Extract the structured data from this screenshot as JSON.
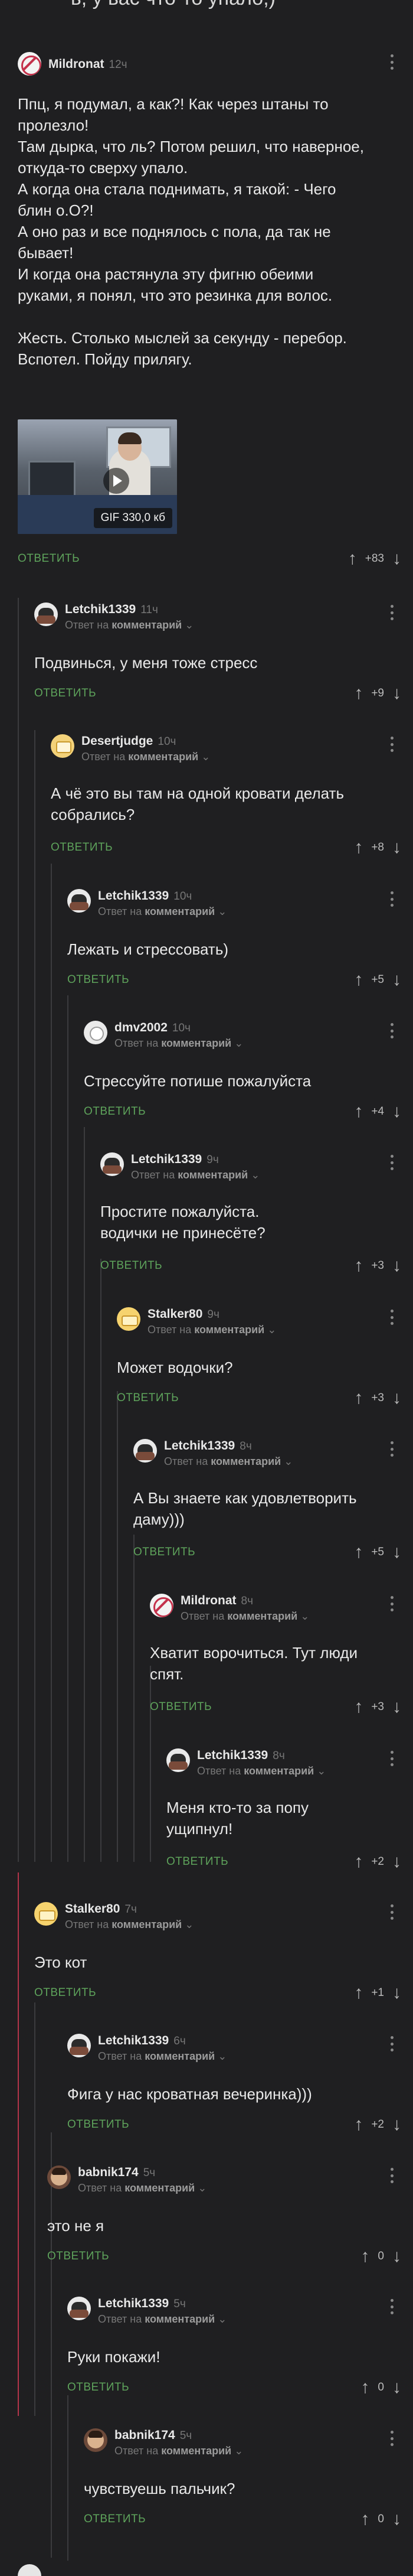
{
  "top_text": "ь, у вас что-то упало,)",
  "comments": [
    {
      "author": "Mildronat",
      "time": "12ч",
      "text": "Ппц, я подумал, а как?! Как через штаны то\nпролезло!\nТам дырка, что ль? Потом решил, что наверное,\nоткуда-то сверху упало.\nА когда она стала поднимать, я такой: - Чего\nблин о.О?!\nА оно раз и все поднялось с пола, да так не\nбывает!\nИ когда она растянула эту фигню обеими\nруками, я понял, что это резинка для волос.\n\nЖесть. Столько мыслей за секунду - перебор.\nВспотел. Пойду прилягу.",
      "gif_label": "GIF 330,0 кб",
      "reply": "ОТВЕТИТЬ",
      "score": "+83"
    },
    {
      "author": "Letchik1339",
      "time": "11ч",
      "reply_prefix": "Ответ на",
      "reply_target": "комментарий",
      "text": "Подвинься, у меня тоже стресс",
      "reply": "ОТВЕТИТЬ",
      "score": "+9"
    },
    {
      "author": "Desertjudge",
      "time": "10ч",
      "reply_prefix": "Ответ на",
      "reply_target": "комментарий",
      "text": "А чё это вы там на одной кровати делать\nсобрались?",
      "reply": "ОТВЕТИТЬ",
      "score": "+8"
    },
    {
      "author": "Letchik1339",
      "time": "10ч",
      "reply_prefix": "Ответ на",
      "reply_target": "комментарий",
      "text": "Лежать и стрессовать)",
      "reply": "ОТВЕТИТЬ",
      "score": "+5"
    },
    {
      "author": "dmv2002",
      "time": "10ч",
      "reply_prefix": "Ответ на",
      "reply_target": "комментарий",
      "text": "Стрессуйте потише пожалуйста",
      "reply": "ОТВЕТИТЬ",
      "score": "+4"
    },
    {
      "author": "Letchik1339",
      "time": "9ч",
      "reply_prefix": "Ответ на",
      "reply_target": "комментарий",
      "text": "Простите пожалуйста.\nводички не принесёте?",
      "reply": "ОТВЕТИТЬ",
      "score": "+3"
    },
    {
      "author": "Stalker80",
      "time": "9ч",
      "reply_prefix": "Ответ на",
      "reply_target": "комментарий",
      "text": "Может водочки?",
      "reply": "ОТВЕТИТЬ",
      "score": "+3"
    },
    {
      "author": "Letchik1339",
      "time": "8ч",
      "reply_prefix": "Ответ на",
      "reply_target": "комментарий",
      "text": "А Вы знаете как удовлетворить\nдаму)))",
      "reply": "ОТВЕТИТЬ",
      "score": "+5"
    },
    {
      "author": "Mildronat",
      "time": "8ч",
      "reply_prefix": "Ответ на",
      "reply_target": "комментарий",
      "text": "Хватит ворочиться. Тут люди\nспят.",
      "reply": "ОТВЕТИТЬ",
      "score": "+3"
    },
    {
      "author": "Letchik1339",
      "time": "8ч",
      "reply_prefix": "Ответ на",
      "reply_target": "комментарий",
      "text": "Меня кто-то за попу\nущипнул!",
      "reply": "ОТВЕТИТЬ",
      "score": "+2"
    },
    {
      "author": "Stalker80",
      "time": "7ч",
      "reply_prefix": "Ответ на",
      "reply_target": "комментарий",
      "text": "Это кот",
      "reply": "ОТВЕТИТЬ",
      "score": "+1"
    },
    {
      "author": "Letchik1339",
      "time": "6ч",
      "reply_prefix": "Ответ на",
      "reply_target": "комментарий",
      "text": "Фига у нас кроватная вечеринка)))",
      "reply": "ОТВЕТИТЬ",
      "score": "+2"
    },
    {
      "author": "babnik174",
      "time": "5ч",
      "reply_prefix": "Ответ на",
      "reply_target": "комментарий",
      "text": "это не я",
      "reply": "ОТВЕТИТЬ",
      "score": "0"
    },
    {
      "author": "Letchik1339",
      "time": "5ч",
      "reply_prefix": "Ответ на",
      "reply_target": "комментарий",
      "text": "Руки покажи!",
      "reply": "ОТВЕТИТЬ",
      "score": "0"
    },
    {
      "author": "babnik174",
      "time": "5ч",
      "reply_prefix": "Ответ на",
      "reply_target": "комментарий",
      "text": "чувствуешь пальчик?",
      "reply": "ОТВЕТИТЬ",
      "score": "0"
    }
  ],
  "icons": {
    "up": "arrow-up-icon",
    "down": "arrow-down-icon",
    "menu": "more-vertical-icon",
    "chevron": "chevron-down-icon"
  },
  "colors": {
    "background": "#1f1f21",
    "reply": "#5ea35b",
    "thread_line": "#3b3b3e",
    "accent": "#b3344a"
  }
}
